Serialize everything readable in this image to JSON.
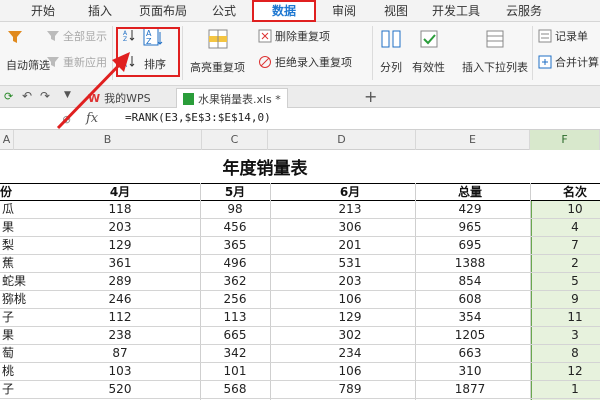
{
  "ribbon": {
    "tabs": [
      "开始",
      "插入",
      "页面布局",
      "公式",
      "数据",
      "审阅",
      "视图",
      "开发工具",
      "云服务"
    ],
    "active_tab": "数据",
    "buttons": {
      "auto_filter": "自动筛选",
      "show_all": "全部显示",
      "reapply": "重新应用",
      "sort": "排序",
      "highlight_duplicates": "高亮重复项",
      "remove_duplicates": "删除重复项",
      "reject_duplicates": "拒绝录入重复项",
      "split_column": "分列",
      "validity": "有效性",
      "insert_dropdown_list": "插入下拉列表",
      "record_form": "记录单",
      "merge_calc": "合并计算"
    }
  },
  "doc_tabs": [
    "我的WPS",
    "水果销量表.xls *"
  ],
  "formula_bar": {
    "cell_ref": "",
    "fx": "fx",
    "formula": "=RANK(E3,$E$3:$E$14,0)"
  },
  "columns": [
    "A",
    "B",
    "C",
    "D",
    "E",
    "F"
  ],
  "sheet": {
    "title": "年度销量表",
    "headers": [
      "份",
      "4月",
      "5月",
      "6月",
      "总量",
      "名次"
    ],
    "rows": [
      [
        "瓜",
        "118",
        "98",
        "213",
        "429",
        "10"
      ],
      [
        "果",
        "203",
        "456",
        "306",
        "965",
        "4"
      ],
      [
        "梨",
        "129",
        "365",
        "201",
        "695",
        "7"
      ],
      [
        "蕉",
        "361",
        "496",
        "531",
        "1388",
        "2"
      ],
      [
        "蛇果",
        "289",
        "362",
        "203",
        "854",
        "5"
      ],
      [
        "猕桃",
        "246",
        "256",
        "106",
        "608",
        "9"
      ],
      [
        "子",
        "112",
        "113",
        "129",
        "354",
        "11"
      ],
      [
        "果",
        "238",
        "665",
        "302",
        "1205",
        "3"
      ],
      [
        "萄",
        "87",
        "342",
        "234",
        "663",
        "8"
      ],
      [
        "桃",
        "103",
        "101",
        "106",
        "310",
        "12"
      ],
      [
        "子",
        "520",
        "568",
        "789",
        "1877",
        "1"
      ]
    ]
  },
  "colors": {
    "accent": "#1f78d1",
    "highlight_red": "#e02020",
    "selection_green": "#e7f2dd"
  }
}
